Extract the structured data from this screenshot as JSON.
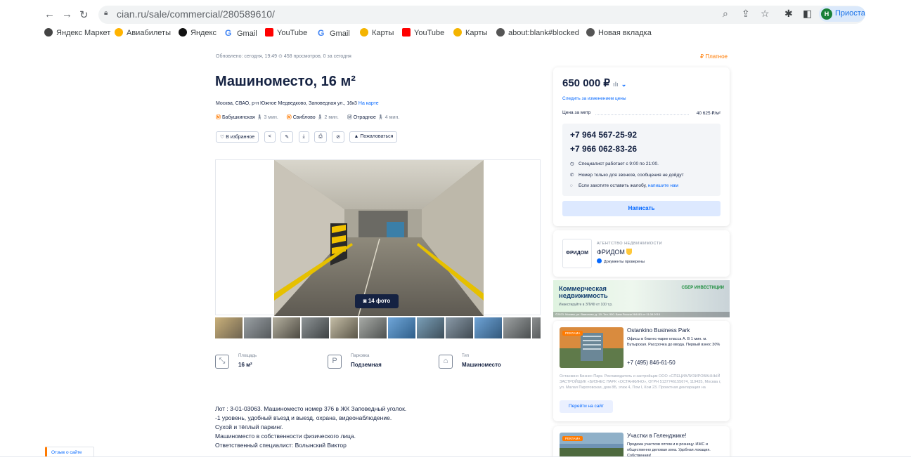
{
  "browser": {
    "url": "cian.ru/sale/commercial/280589610/",
    "profile_initial": "Н",
    "profile_label": "Приоста",
    "bookmarks": [
      {
        "label": "Яндекс Маркет",
        "icon": "market-icon",
        "color": "#444444"
      },
      {
        "label": "Авиабилеты",
        "icon": "plane-icon",
        "color": "#ffb300"
      },
      {
        "label": "Яндекс",
        "icon": "yandex-icon",
        "color": "#111111"
      },
      {
        "label": "Gmail",
        "icon": "google-icon",
        "color": "#4285f4"
      },
      {
        "label": "YouTube",
        "icon": "youtube-icon",
        "color": "#ff0000"
      },
      {
        "label": "Gmail",
        "icon": "google-icon",
        "color": "#4285f4"
      },
      {
        "label": "Карты",
        "icon": "maps-pin-icon",
        "color": "#f4b400"
      },
      {
        "label": "YouTube",
        "icon": "youtube-icon",
        "color": "#ff0000"
      },
      {
        "label": "Карты",
        "icon": "maps-pin-icon",
        "color": "#f4b400"
      },
      {
        "label": "about:blank#blocked",
        "icon": "globe-icon",
        "color": "#555555"
      },
      {
        "label": "Новая вкладка",
        "icon": "globe-icon",
        "color": "#555555"
      }
    ]
  },
  "listing": {
    "meta": "Обновлено: сегодня, 19:49   ⊙ 458 просмотров, 0 за сегодня",
    "paid": "₽ Платное",
    "title": "Машиноместо, 16 м²",
    "address": "Москва, СВАО, р-н Южное Медведково, Заповедная ул., 16к3",
    "map_link": "На карте",
    "metro": [
      {
        "name": "Бабушкинская",
        "time": "3 мин."
      },
      {
        "name": "Свиблово",
        "time": "2 мин."
      },
      {
        "name": "Отрадное",
        "time": "4 мин."
      }
    ],
    "actions": {
      "favorite": "В избранное",
      "complain": "Пожаловаться"
    },
    "photo_count": "14 фото",
    "specs": [
      {
        "label": "Площадь",
        "value": "16 м²",
        "icon": "area-icon"
      },
      {
        "label": "Парковка",
        "value": "Подземная",
        "icon": "parking-icon"
      },
      {
        "label": "Тип",
        "value": "Машиноместо",
        "icon": "garage-icon"
      }
    ],
    "description": [
      "Лот : 3-01-03063. Машиноместо номер 376 в ЖК Заповедный уголок.",
      "-1 уровень, удобный въезд и выезд, охрана, видеонаблюдение.",
      "Сухой и тёплый паркинг.",
      "Машиноместо в собственности физического лица.",
      "Ответственный специалист: Волынский Виктор"
    ],
    "feedback": "Отзыв о сайте"
  },
  "price_card": {
    "price": "650 000 ₽",
    "follow": "Следить за изменением цены",
    "ppm_label": "Цена за метр",
    "ppm_value": "40 625 ₽/м²",
    "phone1": "+7 964 567-25-92",
    "phone2": "+7 966 062-83-26",
    "info1": "Специалист работает с 9:00 по 21:00.",
    "info2": "Номер только для звонков, сообщения не дойдут",
    "info3_text": "Если захотите оставить жалобу,",
    "info3_link": "напишите нам",
    "write": "Написать"
  },
  "agency": {
    "logo": "ФРИДОМ",
    "kind": "АГЕНТСТВО НЕДВИЖИМОСТИ",
    "name": "ФРИДОМ",
    "verified": "Документы проверены"
  },
  "banner": {
    "title_line1": "Коммерческая",
    "title_line2": "недвижимость",
    "sub": "Инвестируйте в ЗПИФ от 100 т.р.",
    "brand": "СБЕР ИНВЕСТИЦИИ",
    "legal": "©2023. Москва, ул. Вавилова, д. 19. Тел. 900. Банк России №1481 от 11.08.2015"
  },
  "ad1": {
    "tag": "РЕКЛАМА",
    "title": "Ostankino Business Park",
    "text": "Офисы в бизнес-парке класса А. В 1 мин. м. Бутырская. Рассрочка до ввода. Первый взнос 30%",
    "phone": "+7 (495) 846-61-50",
    "legal": "Останкино Бизнес Парк. Рекламодатель и застройщик ООО «СПЕЦИАЛИЗИРОВАННЫЙ ЗАСТРОЙЩИК «БИЗНЕС ПАРК «ОСТАНКИНО», ОГРН 5137746155674, 119435, Москва г, ул. Малая Пироговская, дом 8Б, этаж 4, Пом I, Ком 23. Проектная декларация на",
    "button": "Перейти на сайт"
  },
  "ad2": {
    "tag": "РЕКЛАМА",
    "title": "Участки в Геленджике!",
    "text": "Продажа участков оптом и в розницу. ИЖС и общественно деловая зона. Удобная локация. Собственник!"
  }
}
